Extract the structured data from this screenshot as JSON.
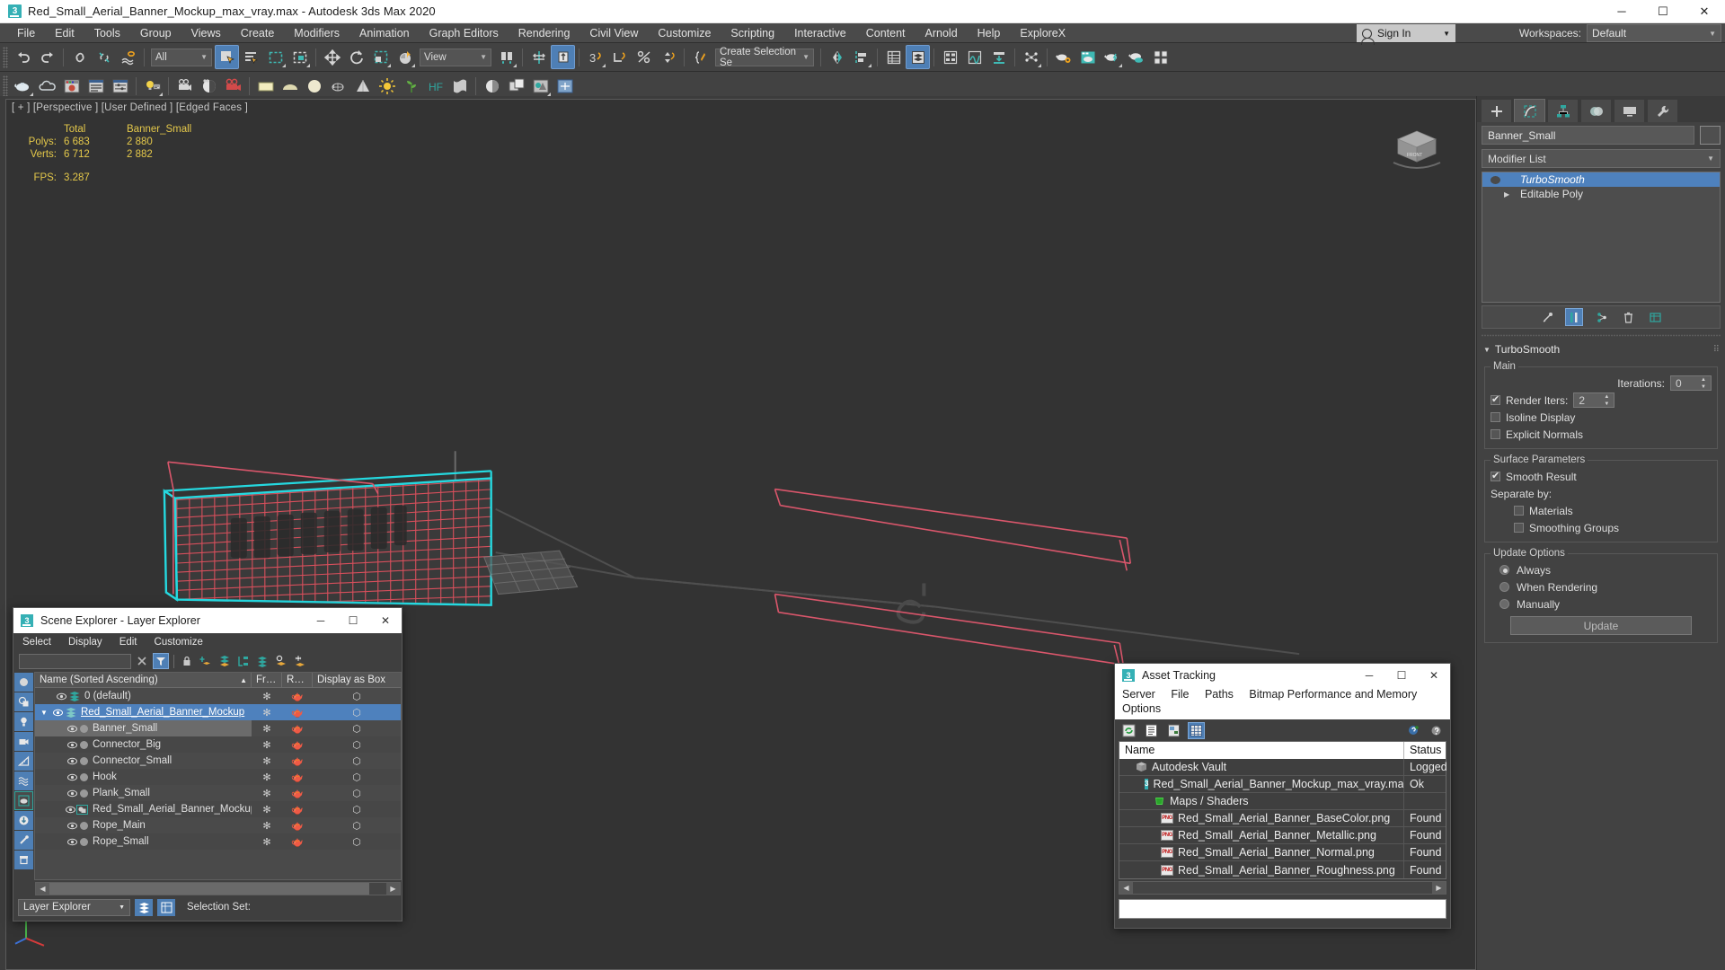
{
  "window": {
    "title": "Red_Small_Aerial_Banner_Mockup_max_vray.max - Autodesk 3ds Max 2020",
    "minimize": "─",
    "maximize": "☐",
    "close": "✕"
  },
  "menubar": {
    "items": [
      "File",
      "Edit",
      "Tools",
      "Group",
      "Views",
      "Create",
      "Modifiers",
      "Animation",
      "Graph Editors",
      "Rendering",
      "Civil View",
      "Customize",
      "Scripting",
      "Interactive",
      "Content",
      "Arnold",
      "Help",
      "ExploreX"
    ],
    "sign_in": "Sign In",
    "workspaces_label": "Workspaces:",
    "workspace_value": "Default"
  },
  "toolbar": {
    "selection_filter": "All",
    "reference_coord": "View",
    "selection_set": "Create Selection Se",
    "undo": "undo-arrow",
    "redo": "redo-arrow"
  },
  "viewport": {
    "label": "[ + ] [Perspective ] [User Defined ] [Edged Faces ]",
    "stats": {
      "col_total": "Total",
      "col_object": "Banner_Small",
      "rows": [
        {
          "label": "Polys:",
          "total": "6 683",
          "object": "2 880"
        },
        {
          "label": "Verts:",
          "total": "6 712",
          "object": "2 882"
        }
      ],
      "fps_label": "FPS:",
      "fps_value": "3.287"
    }
  },
  "command_panel": {
    "tabs": [
      "create-tab",
      "modify-tab",
      "hierarchy-tab",
      "motion-tab",
      "display-tab",
      "utilities-tab"
    ],
    "object_name": "Banner_Small",
    "modifier_list": "Modifier List",
    "stack": [
      {
        "name": "TurboSmooth",
        "selected": true
      },
      {
        "name": "Editable Poly",
        "selected": false
      }
    ],
    "rollout": {
      "title": "TurboSmooth",
      "main_group": "Main",
      "iterations_label": "Iterations:",
      "iterations_value": "0",
      "render_iters_label": "Render Iters:",
      "render_iters_value": "2",
      "render_iters_checked": true,
      "isoline_display": "Isoline Display",
      "isoline_checked": false,
      "explicit_normals": "Explicit Normals",
      "explicit_checked": false,
      "surface_group": "Surface Parameters",
      "smooth_result": "Smooth Result",
      "smooth_checked": true,
      "separate_by": "Separate by:",
      "materials": "Materials",
      "materials_checked": false,
      "smoothing_groups": "Smoothing Groups",
      "smoothing_checked": false,
      "update_group": "Update Options",
      "always": "Always",
      "when_rendering": "When Rendering",
      "manually": "Manually",
      "selected_update": "Always",
      "update_button": "Update"
    }
  },
  "scene_explorer": {
    "title": "Scene Explorer - Layer Explorer",
    "menu": [
      "Select",
      "Display",
      "Edit",
      "Customize"
    ],
    "search_value": "",
    "columns": [
      "Name (Sorted Ascending)",
      "Fr…",
      "R…",
      "Display as Box"
    ],
    "rows": [
      {
        "name": "0 (default)",
        "indent": 0,
        "type": "layer",
        "selected": false,
        "highlight": false
      },
      {
        "name": "Red_Small_Aerial_Banner_Mockup",
        "indent": 0,
        "type": "layer",
        "selected": true,
        "highlight": false,
        "expanded": true
      },
      {
        "name": "Banner_Small",
        "indent": 1,
        "type": "object",
        "selected": false,
        "highlight": true
      },
      {
        "name": "Connector_Big",
        "indent": 1,
        "type": "object",
        "selected": false,
        "highlight": false
      },
      {
        "name": "Connector_Small",
        "indent": 1,
        "type": "object",
        "selected": false,
        "highlight": false
      },
      {
        "name": "Hook",
        "indent": 1,
        "type": "object",
        "selected": false,
        "highlight": false
      },
      {
        "name": "Plank_Small",
        "indent": 1,
        "type": "object",
        "selected": false,
        "highlight": false
      },
      {
        "name": "Red_Small_Aerial_Banner_Mockup",
        "indent": 1,
        "type": "group",
        "selected": false,
        "highlight": false
      },
      {
        "name": "Rope_Main",
        "indent": 1,
        "type": "object",
        "selected": false,
        "highlight": false
      },
      {
        "name": "Rope_Small",
        "indent": 1,
        "type": "object",
        "selected": false,
        "highlight": false
      }
    ],
    "footer_combo": "Layer Explorer",
    "selection_set_label": "Selection Set:"
  },
  "asset_tracking": {
    "title": "Asset Tracking",
    "menu": [
      "Server",
      "File",
      "Paths",
      "Bitmap Performance and Memory",
      "Options"
    ],
    "columns": {
      "name": "Name",
      "status": "Status"
    },
    "rows": [
      {
        "name": "Autodesk Vault",
        "status": "Logged",
        "indent": 0,
        "icon": "vault-icon"
      },
      {
        "name": "Red_Small_Aerial_Banner_Mockup_max_vray.max",
        "status": "Ok",
        "indent": 1,
        "icon": "max-file-icon"
      },
      {
        "name": "Maps / Shaders",
        "status": "",
        "indent": 2,
        "icon": "maps-icon"
      },
      {
        "name": "Red_Small_Aerial_Banner_BaseColor.png",
        "status": "Found",
        "indent": 3,
        "icon": "png-icon"
      },
      {
        "name": "Red_Small_Aerial_Banner_Metallic.png",
        "status": "Found",
        "indent": 3,
        "icon": "png-icon"
      },
      {
        "name": "Red_Small_Aerial_Banner_Normal.png",
        "status": "Found",
        "indent": 3,
        "icon": "png-icon"
      },
      {
        "name": "Red_Small_Aerial_Banner_Roughness.png",
        "status": "Found",
        "indent": 3,
        "icon": "png-icon"
      }
    ]
  },
  "colors": {
    "accent": "#4e81bd",
    "stat_yellow": "#e4c84a",
    "mesh_red": "#e0515e",
    "mesh_cyan": "#25d9e0",
    "panel_bg": "#424242",
    "viewport_bg": "#333333"
  }
}
